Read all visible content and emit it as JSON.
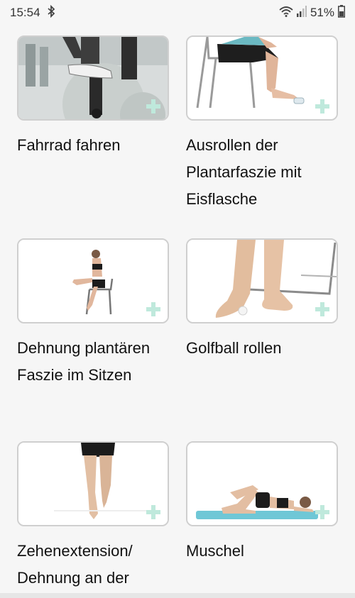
{
  "status_bar": {
    "time": "15:54",
    "battery_percent": "51%",
    "icons": [
      "bluetooth-icon",
      "wifi-icon",
      "signal-icon",
      "battery-icon"
    ]
  },
  "exercises": [
    {
      "title": "Fahrrad fahren",
      "image": "stationary-bike-photo"
    },
    {
      "title": "Ausrollen der Plantarfaszie mit Eisflasche",
      "image": "seated-ice-bottle-roll-photo"
    },
    {
      "title": "Dehnung plantären Faszie im Sitzen",
      "image": "seated-plantar-stretch-photo"
    },
    {
      "title": "Golfball rollen",
      "image": "golf-ball-roll-photo"
    },
    {
      "title": "Zehenextension/ Dehnung an der",
      "image": "toe-extension-photo"
    },
    {
      "title": "Muschel",
      "image": "clamshell-exercise-photo"
    }
  ],
  "colors": {
    "plus_icon": "#bfe9dc",
    "mat": "#6fc7d6"
  }
}
